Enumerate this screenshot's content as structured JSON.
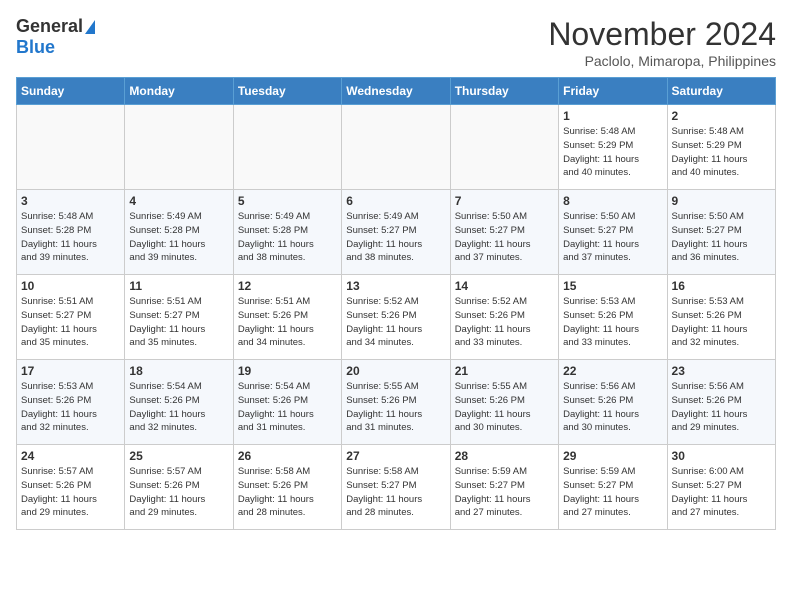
{
  "logo": {
    "general": "General",
    "blue": "Blue"
  },
  "title": "November 2024",
  "location": "Paclolo, Mimaropa, Philippines",
  "weekdays": [
    "Sunday",
    "Monday",
    "Tuesday",
    "Wednesday",
    "Thursday",
    "Friday",
    "Saturday"
  ],
  "weeks": [
    [
      {
        "day": "",
        "detail": ""
      },
      {
        "day": "",
        "detail": ""
      },
      {
        "day": "",
        "detail": ""
      },
      {
        "day": "",
        "detail": ""
      },
      {
        "day": "",
        "detail": ""
      },
      {
        "day": "1",
        "detail": "Sunrise: 5:48 AM\nSunset: 5:29 PM\nDaylight: 11 hours\nand 40 minutes."
      },
      {
        "day": "2",
        "detail": "Sunrise: 5:48 AM\nSunset: 5:29 PM\nDaylight: 11 hours\nand 40 minutes."
      }
    ],
    [
      {
        "day": "3",
        "detail": "Sunrise: 5:48 AM\nSunset: 5:28 PM\nDaylight: 11 hours\nand 39 minutes."
      },
      {
        "day": "4",
        "detail": "Sunrise: 5:49 AM\nSunset: 5:28 PM\nDaylight: 11 hours\nand 39 minutes."
      },
      {
        "day": "5",
        "detail": "Sunrise: 5:49 AM\nSunset: 5:28 PM\nDaylight: 11 hours\nand 38 minutes."
      },
      {
        "day": "6",
        "detail": "Sunrise: 5:49 AM\nSunset: 5:27 PM\nDaylight: 11 hours\nand 38 minutes."
      },
      {
        "day": "7",
        "detail": "Sunrise: 5:50 AM\nSunset: 5:27 PM\nDaylight: 11 hours\nand 37 minutes."
      },
      {
        "day": "8",
        "detail": "Sunrise: 5:50 AM\nSunset: 5:27 PM\nDaylight: 11 hours\nand 37 minutes."
      },
      {
        "day": "9",
        "detail": "Sunrise: 5:50 AM\nSunset: 5:27 PM\nDaylight: 11 hours\nand 36 minutes."
      }
    ],
    [
      {
        "day": "10",
        "detail": "Sunrise: 5:51 AM\nSunset: 5:27 PM\nDaylight: 11 hours\nand 35 minutes."
      },
      {
        "day": "11",
        "detail": "Sunrise: 5:51 AM\nSunset: 5:27 PM\nDaylight: 11 hours\nand 35 minutes."
      },
      {
        "day": "12",
        "detail": "Sunrise: 5:51 AM\nSunset: 5:26 PM\nDaylight: 11 hours\nand 34 minutes."
      },
      {
        "day": "13",
        "detail": "Sunrise: 5:52 AM\nSunset: 5:26 PM\nDaylight: 11 hours\nand 34 minutes."
      },
      {
        "day": "14",
        "detail": "Sunrise: 5:52 AM\nSunset: 5:26 PM\nDaylight: 11 hours\nand 33 minutes."
      },
      {
        "day": "15",
        "detail": "Sunrise: 5:53 AM\nSunset: 5:26 PM\nDaylight: 11 hours\nand 33 minutes."
      },
      {
        "day": "16",
        "detail": "Sunrise: 5:53 AM\nSunset: 5:26 PM\nDaylight: 11 hours\nand 32 minutes."
      }
    ],
    [
      {
        "day": "17",
        "detail": "Sunrise: 5:53 AM\nSunset: 5:26 PM\nDaylight: 11 hours\nand 32 minutes."
      },
      {
        "day": "18",
        "detail": "Sunrise: 5:54 AM\nSunset: 5:26 PM\nDaylight: 11 hours\nand 32 minutes."
      },
      {
        "day": "19",
        "detail": "Sunrise: 5:54 AM\nSunset: 5:26 PM\nDaylight: 11 hours\nand 31 minutes."
      },
      {
        "day": "20",
        "detail": "Sunrise: 5:55 AM\nSunset: 5:26 PM\nDaylight: 11 hours\nand 31 minutes."
      },
      {
        "day": "21",
        "detail": "Sunrise: 5:55 AM\nSunset: 5:26 PM\nDaylight: 11 hours\nand 30 minutes."
      },
      {
        "day": "22",
        "detail": "Sunrise: 5:56 AM\nSunset: 5:26 PM\nDaylight: 11 hours\nand 30 minutes."
      },
      {
        "day": "23",
        "detail": "Sunrise: 5:56 AM\nSunset: 5:26 PM\nDaylight: 11 hours\nand 29 minutes."
      }
    ],
    [
      {
        "day": "24",
        "detail": "Sunrise: 5:57 AM\nSunset: 5:26 PM\nDaylight: 11 hours\nand 29 minutes."
      },
      {
        "day": "25",
        "detail": "Sunrise: 5:57 AM\nSunset: 5:26 PM\nDaylight: 11 hours\nand 29 minutes."
      },
      {
        "day": "26",
        "detail": "Sunrise: 5:58 AM\nSunset: 5:26 PM\nDaylight: 11 hours\nand 28 minutes."
      },
      {
        "day": "27",
        "detail": "Sunrise: 5:58 AM\nSunset: 5:27 PM\nDaylight: 11 hours\nand 28 minutes."
      },
      {
        "day": "28",
        "detail": "Sunrise: 5:59 AM\nSunset: 5:27 PM\nDaylight: 11 hours\nand 27 minutes."
      },
      {
        "day": "29",
        "detail": "Sunrise: 5:59 AM\nSunset: 5:27 PM\nDaylight: 11 hours\nand 27 minutes."
      },
      {
        "day": "30",
        "detail": "Sunrise: 6:00 AM\nSunset: 5:27 PM\nDaylight: 11 hours\nand 27 minutes."
      }
    ]
  ]
}
